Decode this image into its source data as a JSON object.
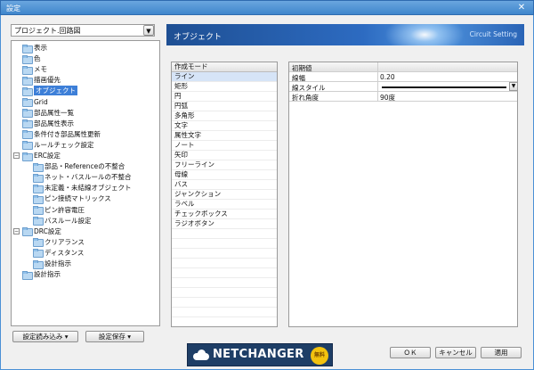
{
  "window": {
    "title": "設定",
    "close_glyph": "✕"
  },
  "project_select": {
    "value": "プロジェクト.回路図"
  },
  "tree": [
    {
      "label": "表示",
      "level": 1
    },
    {
      "label": "色",
      "level": 1
    },
    {
      "label": "メモ",
      "level": 1
    },
    {
      "label": "描画優先",
      "level": 1
    },
    {
      "label": "オブジェクト",
      "level": 1,
      "selected": true
    },
    {
      "label": "Grid",
      "level": 1
    },
    {
      "label": "部品属性一覧",
      "level": 1
    },
    {
      "label": "部品属性表示",
      "level": 1
    },
    {
      "label": "条件付き部品属性更新",
      "level": 1
    },
    {
      "label": "ルールチェック設定",
      "level": 1
    },
    {
      "label": "ERC設定",
      "level": 1,
      "expander": "⊟"
    },
    {
      "label": "部品・Referenceの不整合",
      "level": 2
    },
    {
      "label": "ネット・バスルールの不整合",
      "level": 2
    },
    {
      "label": "未定義・未結線オブジェクト",
      "level": 2
    },
    {
      "label": "ピン接続マトリックス",
      "level": 2
    },
    {
      "label": "ピン許容電圧",
      "level": 2
    },
    {
      "label": "バスルール設定",
      "level": 2
    },
    {
      "label": "DRC設定",
      "level": 1,
      "expander": "⊟"
    },
    {
      "label": "クリアランス",
      "level": 2
    },
    {
      "label": "ディスタンス",
      "level": 2
    },
    {
      "label": "設計指示",
      "level": 2
    },
    {
      "label": "設計指示",
      "level": 1
    }
  ],
  "banner": {
    "title": "オブジェクト",
    "subtitle": "Circuit Setting"
  },
  "mode_panel": {
    "header": "作成モード",
    "items": [
      "ライン",
      "矩形",
      "円",
      "円弧",
      "多角形",
      "文字",
      "属性文字",
      "ノート",
      "矢印",
      "フリーライン",
      "母線",
      "バス",
      "ジャンクション",
      "ラベル",
      "チェックボックス",
      "ラジオボタン"
    ],
    "selected_index": 0
  },
  "properties": {
    "header": "初期値",
    "rows": [
      {
        "key": "線幅",
        "value": "0.20"
      },
      {
        "key": "線スタイル",
        "value": ""
      },
      {
        "key": "折れ角度",
        "value": "90度"
      }
    ]
  },
  "buttons": {
    "load": "設定読み込み ▾",
    "save": "設定保存 ▾",
    "ok": "ＯＫ",
    "cancel": "キャンセル",
    "apply": "適用"
  },
  "logo": {
    "text": "NETCHANGER",
    "badge": "無料"
  }
}
